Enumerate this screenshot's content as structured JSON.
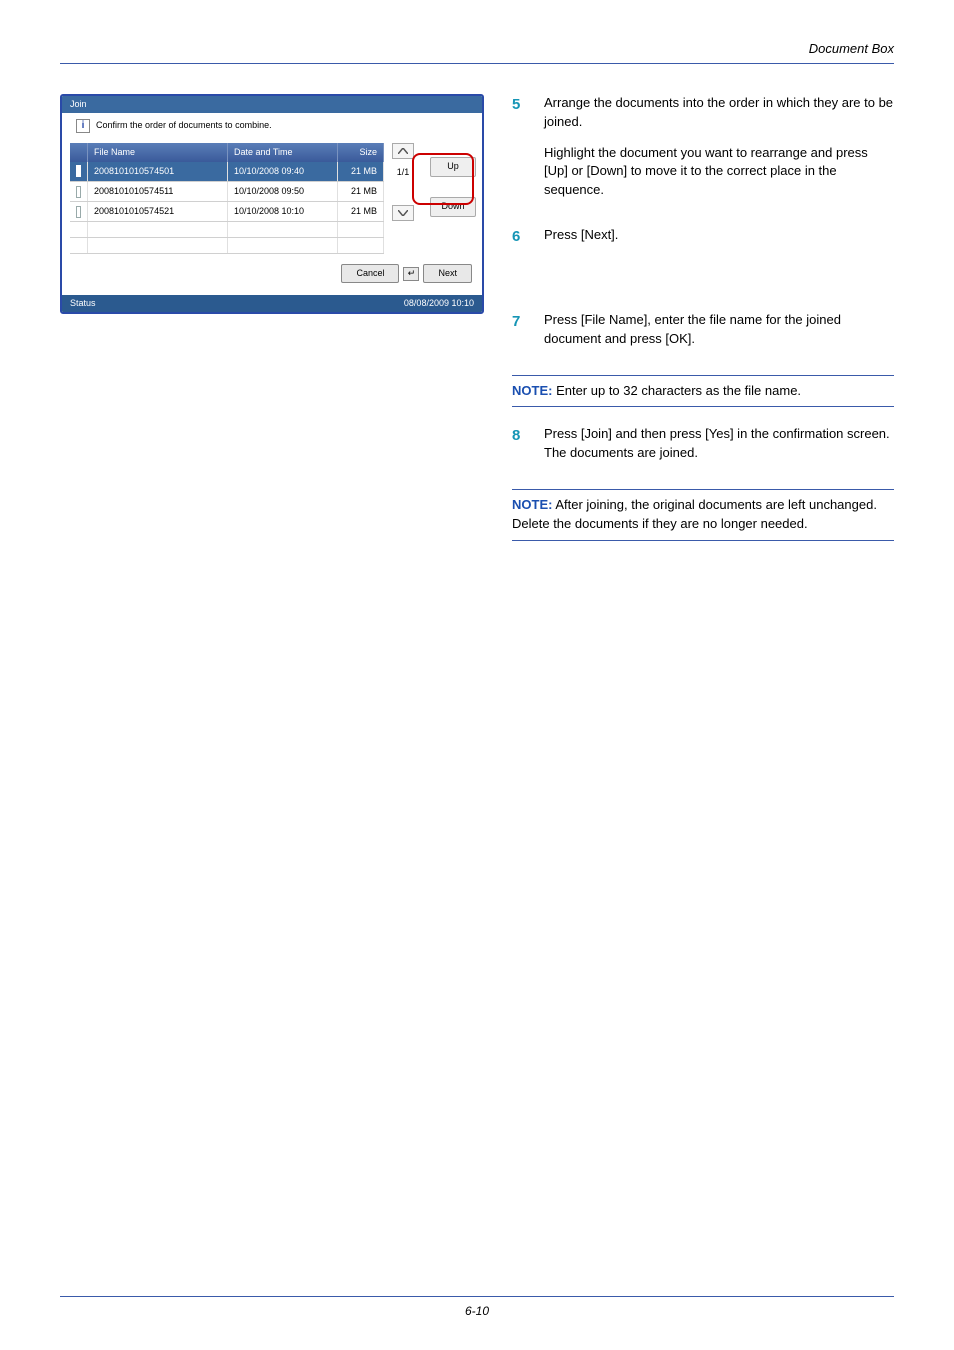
{
  "header": {
    "title": "Document Box"
  },
  "panel": {
    "title": "Join",
    "instruction": "Confirm the order of documents to combine.",
    "columns": {
      "name": "File Name",
      "datetime": "Date and Time",
      "size": "Size"
    },
    "rows": [
      {
        "name": "2008101010574501",
        "dt": "10/10/2008  09:40",
        "size": "21 MB",
        "selected": true
      },
      {
        "name": "2008101010574511",
        "dt": "10/10/2008  09:50",
        "size": "21 MB",
        "selected": false
      },
      {
        "name": "2008101010574521",
        "dt": "10/10/2008  10:10",
        "size": "21 MB",
        "selected": false
      },
      {
        "name": "",
        "dt": "",
        "size": "",
        "selected": false
      },
      {
        "name": "",
        "dt": "",
        "size": "",
        "selected": false
      }
    ],
    "page_indicator": "1/1",
    "up_label": "Up",
    "down_label": "Down",
    "cancel_label": "Cancel",
    "next_label": "Next",
    "status_label": "Status",
    "status_time": "08/08/2009   10:10"
  },
  "steps": {
    "s5": {
      "num": "5",
      "p1": "Arrange the documents into the order in which they are to be joined.",
      "p2": "Highlight the document you want to rearrange and press [Up] or [Down] to move it to the correct place in the sequence."
    },
    "s6": {
      "num": "6",
      "p1": "Press [Next]."
    },
    "s7": {
      "num": "7",
      "p1": "Press [File Name], enter the file name for the joined document and press [OK]."
    },
    "s8": {
      "num": "8",
      "p1": "Press [Join] and then press [Yes] in the confirmation screen. The documents are joined."
    }
  },
  "notes": {
    "label": "NOTE:",
    "n1": " Enter up to 32 characters as the file name.",
    "n2": " After joining, the original documents are left unchanged. Delete the documents if they are no longer needed."
  },
  "footer": {
    "page": "6-10"
  }
}
